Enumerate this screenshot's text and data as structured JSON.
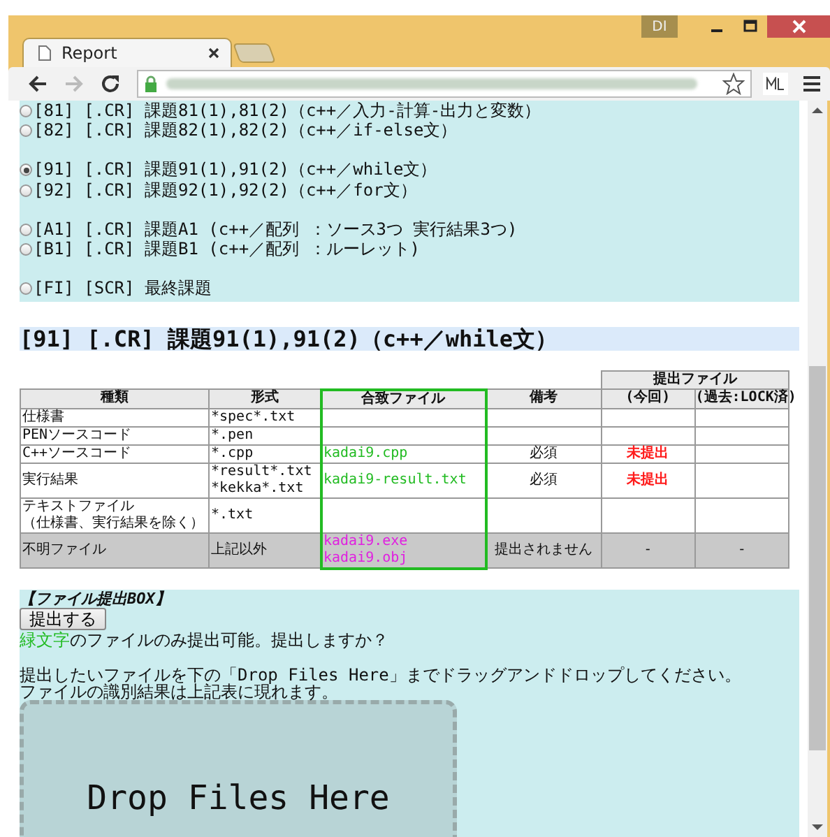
{
  "window": {
    "profile_badge": "DI"
  },
  "tabs": [
    {
      "label": "Report",
      "selected": true
    }
  ],
  "assignments": {
    "groups": [
      [
        {
          "label": "[81] [.CR] 課題81(1),81(2)（c++／入力-計算-出力と変数）",
          "selected": false
        },
        {
          "label": "[82] [.CR] 課題82(1),82(2)（c++／if-else文）",
          "selected": false
        }
      ],
      [
        {
          "label": "[91] [.CR] 課題91(1),91(2)（c++／while文）",
          "selected": true
        },
        {
          "label": "[92] [.CR] 課題92(1),92(2)（c++／for文）",
          "selected": false
        }
      ],
      [
        {
          "label": "[A1] [.CR] 課題A1 (c++／配列 ：ソース3つ 実行結果3つ)",
          "selected": false
        },
        {
          "label": "[B1] [.CR] 課題B1 (c++／配列  ：ルーレット)",
          "selected": false
        }
      ],
      [
        {
          "label": "[FI] [SCR] 最終課題",
          "selected": false
        }
      ]
    ]
  },
  "heading": "[91] [.CR] 課題91(1),91(2)（c++／while文）",
  "table": {
    "group_header": "提出ファイル",
    "columns": [
      "種類",
      "形式",
      "合致ファイル",
      "備考",
      "(今回)",
      "(過去:LOCK済)"
    ],
    "rows": [
      {
        "kind": "known",
        "type": [
          "仕様書"
        ],
        "format": [
          "*spec*.txt"
        ]
      },
      {
        "kind": "known",
        "type": [
          "PENソースコード"
        ],
        "format": [
          "*.pen"
        ]
      },
      {
        "kind": "known",
        "type": [
          "C++ソースコード"
        ],
        "format": [
          "*.cpp"
        ],
        "files": [
          {
            "name": "kadai9.cpp",
            "color": "#22bb22"
          }
        ],
        "note": "必須",
        "current": {
          "text": "未提出",
          "missing": true
        }
      },
      {
        "kind": "known",
        "type": [
          "実行結果"
        ],
        "format": [
          "*result*.txt",
          "*kekka*.txt"
        ],
        "files": [
          {
            "name": "kadai9-result.txt",
            "color": "#22bb22"
          }
        ],
        "note": "必須",
        "current": {
          "text": "未提出",
          "missing": true
        }
      },
      {
        "kind": "known",
        "type": [
          "テキストファイル",
          "（仕様書、実行結果を除く）"
        ],
        "format": [
          "*.txt"
        ]
      },
      {
        "kind": "unknown",
        "type": [
          "不明ファイル"
        ],
        "format": [
          "上記以外"
        ],
        "files": [
          {
            "name": "kadai9.exe",
            "color": "#e020e0"
          },
          {
            "name": "kadai9.obj",
            "color": "#e020e0"
          }
        ],
        "note": "提出されません",
        "current": {
          "text": "-",
          "missing": false
        },
        "past": "-"
      }
    ]
  },
  "submit_box": {
    "title": "【ファイル提出BOX】",
    "button": "提出する",
    "note": {
      "highlight": "緑文字",
      "text": "のファイルのみ提出可能。提出しますか？"
    },
    "instructions": [
      "提出したいファイルを下の「Drop Files Here」までドラッグアンドドロップしてください。",
      "ファイルの識別結果は上記表に現れます。"
    ],
    "drop_zone": "Drop Files Here"
  }
}
